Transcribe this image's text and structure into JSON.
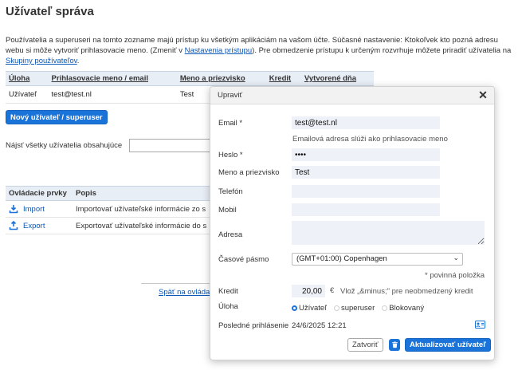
{
  "page": {
    "title": "Užívateľ správa",
    "intro_part1": "Používatelia a superuseri na tomto zozname majú prístup ku všetkým aplikáciám na vašom účte. Súčasné nastavenie: Ktokoľvek kto pozná adresu webu si môže vytvoriť prihlasovacie meno. (Zmeniť v ",
    "intro_link1": "Nastavenia prístupu",
    "intro_part2": "). Pre obmedzenie prístupu k určeným rozvrhuje môžete priradiť užívatelia na ",
    "intro_link2": "Skupiny používateľov",
    "intro_part3": "."
  },
  "users_table": {
    "headers": [
      "Úloha",
      "Prihlasovacie meno / email",
      "Meno a priezvisko",
      "Kredit",
      "Vytvorené dňa"
    ],
    "rows": [
      {
        "role": "Užívateľ",
        "login": "test@test.nl",
        "name": "Test"
      }
    ]
  },
  "new_user_button": "Nový užívateľ / superuser",
  "search": {
    "label": "Nájsť všetky užívatelia obsahujúce",
    "value": ""
  },
  "tools_table": {
    "headers": [
      "Ovládacie prvky",
      "Popis"
    ],
    "rows": [
      {
        "label": "Import",
        "icon": "import-icon",
        "description": "Importovať užívateľské informácie zo s"
      },
      {
        "label": "Export",
        "icon": "export-icon",
        "description": "Exportovať užívateľské informácie do s"
      }
    ]
  },
  "back_link": "Späť na ovláda",
  "dialog": {
    "title": "Upraviť",
    "email_label": "Email *",
    "email_value": "test@test.nl",
    "email_hint": "Emailová adresa slúži ako prihlasovacie meno",
    "password_label": "Heslo *",
    "password_value": "••••",
    "name_label": "Meno a priezvisko",
    "name_value": "Test",
    "phone_label": "Telefón",
    "phone_value": "",
    "mobile_label": "Mobil",
    "mobile_value": "",
    "address_label": "Adresa",
    "address_value": "",
    "timezone_label": "Časové pásmo",
    "timezone_value": "(GMT+01:00) Copenhagen",
    "required_note": "* povinná položka",
    "credit_label": "Kredit",
    "credit_value": "20,00",
    "credit_unit": "€",
    "credit_hint": "Vlož „&minus;\" pre neobmedzený kredit",
    "role_label": "Úloha",
    "role_options": [
      {
        "label": "Užívateľ",
        "checked": true
      },
      {
        "label": "superuser",
        "checked": false
      },
      {
        "label": "Blokovaný",
        "checked": false
      }
    ],
    "last_login_label": "Posledné prihlásenie",
    "last_login_value": "24/6/2025 12:21",
    "close_button": "Zatvoriť",
    "update_button": "Aktualizovať užívateľ"
  },
  "colors": {
    "accent": "#1a73d9",
    "field_bg": "#eef1f7",
    "header_bg": "#e8eef6"
  }
}
